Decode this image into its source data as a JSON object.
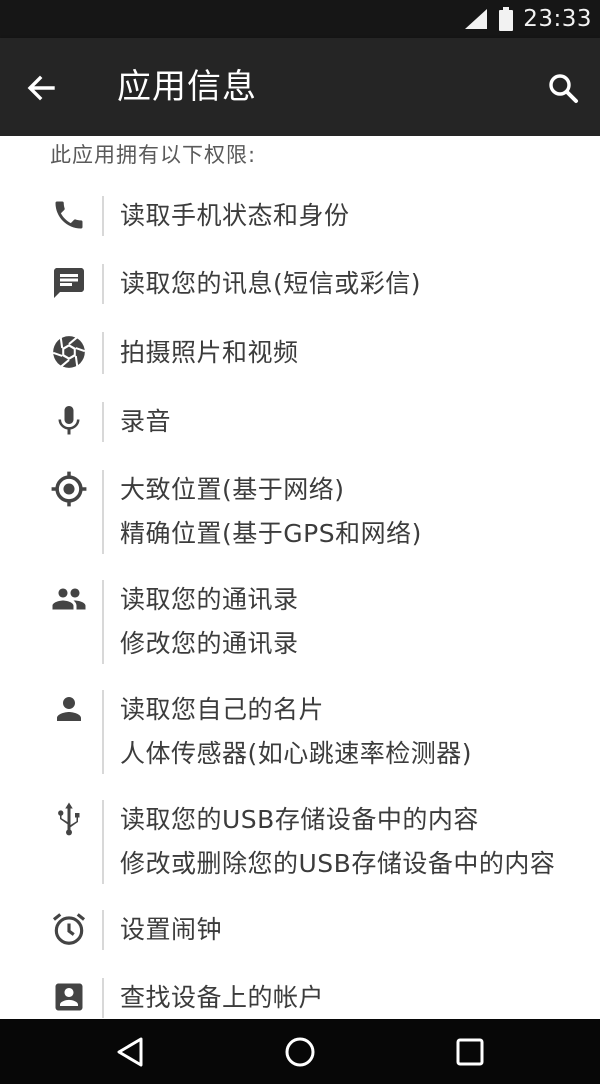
{
  "status_bar": {
    "time": "23:33",
    "icons": [
      "signal-icon",
      "battery-icon"
    ]
  },
  "toolbar": {
    "title": "应用信息",
    "back_icon": "arrow-back-icon",
    "search_icon": "search-icon"
  },
  "content": {
    "intro": "此应用拥有以下权限:",
    "permissions": [
      {
        "icon": "phone-icon",
        "lines": [
          "读取手机状态和身份"
        ]
      },
      {
        "icon": "message-icon",
        "lines": [
          "读取您的讯息(短信或彩信)"
        ]
      },
      {
        "icon": "camera-aperture-icon",
        "lines": [
          "拍摄照片和视频"
        ]
      },
      {
        "icon": "microphone-icon",
        "lines": [
          "录音"
        ]
      },
      {
        "icon": "location-icon",
        "lines": [
          "大致位置(基于网络)",
          "精确位置(基于GPS和网络)"
        ]
      },
      {
        "icon": "contacts-icon",
        "lines": [
          "读取您的通讯录",
          "修改您的通讯录"
        ]
      },
      {
        "icon": "person-icon",
        "lines": [
          "读取您自己的名片",
          "人体传感器(如心跳速率检测器)"
        ]
      },
      {
        "icon": "usb-icon",
        "lines": [
          "读取您的USB存储设备中的内容",
          "修改或删除您的USB存储设备中的内容"
        ]
      },
      {
        "icon": "alarm-icon",
        "lines": [
          "设置闹钟"
        ]
      },
      {
        "icon": "account-icon",
        "lines": [
          "查找设备上的帐户"
        ]
      }
    ]
  },
  "nav_bar": {
    "buttons": [
      "nav-back-icon",
      "nav-home-icon",
      "nav-recents-icon"
    ]
  }
}
